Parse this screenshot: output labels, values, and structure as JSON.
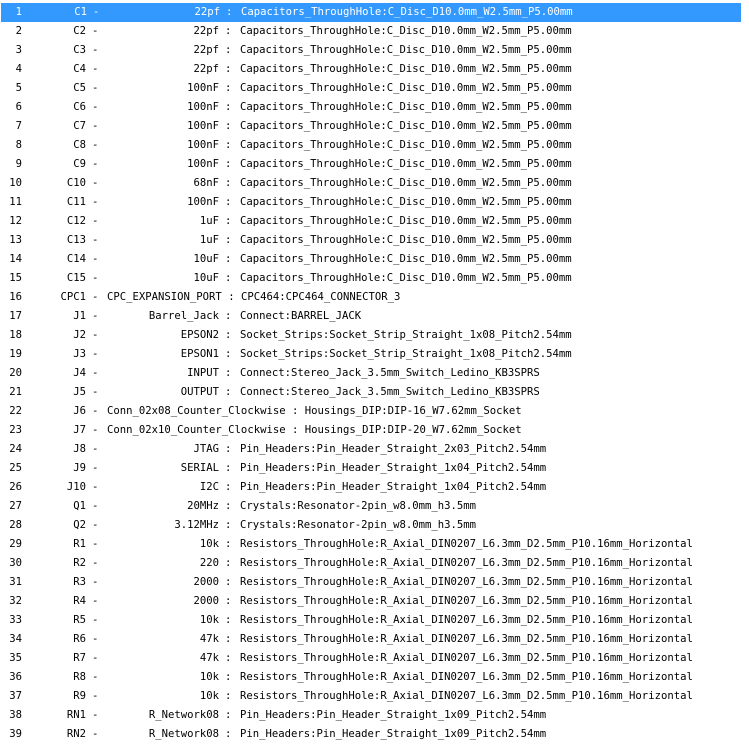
{
  "colors": {
    "selection": "#3399ff",
    "selection_text": "#ffffff",
    "text": "#000000",
    "background": "#ffffff"
  },
  "rows": [
    {
      "num": "1",
      "ref": "C1",
      "value": "22pf",
      "footprint": "Capacitors_ThroughHole:C_Disc_D10.0mm_W2.5mm_P5.00mm"
    },
    {
      "num": "2",
      "ref": "C2",
      "value": "22pf",
      "footprint": "Capacitors_ThroughHole:C_Disc_D10.0mm_W2.5mm_P5.00mm"
    },
    {
      "num": "3",
      "ref": "C3",
      "value": "22pf",
      "footprint": "Capacitors_ThroughHole:C_Disc_D10.0mm_W2.5mm_P5.00mm"
    },
    {
      "num": "4",
      "ref": "C4",
      "value": "22pf",
      "footprint": "Capacitors_ThroughHole:C_Disc_D10.0mm_W2.5mm_P5.00mm"
    },
    {
      "num": "5",
      "ref": "C5",
      "value": "100nF",
      "footprint": "Capacitors_ThroughHole:C_Disc_D10.0mm_W2.5mm_P5.00mm"
    },
    {
      "num": "6",
      "ref": "C6",
      "value": "100nF",
      "footprint": "Capacitors_ThroughHole:C_Disc_D10.0mm_W2.5mm_P5.00mm"
    },
    {
      "num": "7",
      "ref": "C7",
      "value": "100nF",
      "footprint": "Capacitors_ThroughHole:C_Disc_D10.0mm_W2.5mm_P5.00mm"
    },
    {
      "num": "8",
      "ref": "C8",
      "value": "100nF",
      "footprint": "Capacitors_ThroughHole:C_Disc_D10.0mm_W2.5mm_P5.00mm"
    },
    {
      "num": "9",
      "ref": "C9",
      "value": "100nF",
      "footprint": "Capacitors_ThroughHole:C_Disc_D10.0mm_W2.5mm_P5.00mm"
    },
    {
      "num": "10",
      "ref": "C10",
      "value": "68nF",
      "footprint": "Capacitors_ThroughHole:C_Disc_D10.0mm_W2.5mm_P5.00mm"
    },
    {
      "num": "11",
      "ref": "C11",
      "value": "100nF",
      "footprint": "Capacitors_ThroughHole:C_Disc_D10.0mm_W2.5mm_P5.00mm"
    },
    {
      "num": "12",
      "ref": "C12",
      "value": "1uF",
      "footprint": "Capacitors_ThroughHole:C_Disc_D10.0mm_W2.5mm_P5.00mm"
    },
    {
      "num": "13",
      "ref": "C13",
      "value": "1uF",
      "footprint": "Capacitors_ThroughHole:C_Disc_D10.0mm_W2.5mm_P5.00mm"
    },
    {
      "num": "14",
      "ref": "C14",
      "value": "10uF",
      "footprint": "Capacitors_ThroughHole:C_Disc_D10.0mm_W2.5mm_P5.00mm"
    },
    {
      "num": "15",
      "ref": "C15",
      "value": "10uF",
      "footprint": "Capacitors_ThroughHole:C_Disc_D10.0mm_W2.5mm_P5.00mm"
    },
    {
      "num": "16",
      "ref": "CPC1",
      "value": "CPC_EXPANSION_PORT",
      "footprint": "CPC464:CPC464_CONNECTOR_3",
      "long": true
    },
    {
      "num": "17",
      "ref": "J1",
      "value": "Barrel_Jack",
      "footprint": "Connect:BARREL_JACK"
    },
    {
      "num": "18",
      "ref": "J2",
      "value": "EPSON2",
      "footprint": "Socket_Strips:Socket_Strip_Straight_1x08_Pitch2.54mm"
    },
    {
      "num": "19",
      "ref": "J3",
      "value": "EPSON1",
      "footprint": "Socket_Strips:Socket_Strip_Straight_1x08_Pitch2.54mm"
    },
    {
      "num": "20",
      "ref": "J4",
      "value": "INPUT",
      "footprint": "Connect:Stereo_Jack_3.5mm_Switch_Ledino_KB3SPRS"
    },
    {
      "num": "21",
      "ref": "J5",
      "value": "OUTPUT",
      "footprint": "Connect:Stereo_Jack_3.5mm_Switch_Ledino_KB3SPRS"
    },
    {
      "num": "22",
      "ref": "J6",
      "value": "Conn_02x08_Counter_Clockwise",
      "footprint": "Housings_DIP:DIP-16_W7.62mm_Socket",
      "long": true
    },
    {
      "num": "23",
      "ref": "J7",
      "value": "Conn_02x10_Counter_Clockwise",
      "footprint": "Housings_DIP:DIP-20_W7.62mm_Socket",
      "long": true
    },
    {
      "num": "24",
      "ref": "J8",
      "value": "JTAG",
      "footprint": "Pin_Headers:Pin_Header_Straight_2x03_Pitch2.54mm"
    },
    {
      "num": "25",
      "ref": "J9",
      "value": "SERIAL",
      "footprint": "Pin_Headers:Pin_Header_Straight_1x04_Pitch2.54mm"
    },
    {
      "num": "26",
      "ref": "J10",
      "value": "I2C",
      "footprint": "Pin_Headers:Pin_Header_Straight_1x04_Pitch2.54mm"
    },
    {
      "num": "27",
      "ref": "Q1",
      "value": "20MHz",
      "footprint": "Crystals:Resonator-2pin_w8.0mm_h3.5mm"
    },
    {
      "num": "28",
      "ref": "Q2",
      "value": "3.12MHz",
      "footprint": "Crystals:Resonator-2pin_w8.0mm_h3.5mm"
    },
    {
      "num": "29",
      "ref": "R1",
      "value": "10k",
      "footprint": "Resistors_ThroughHole:R_Axial_DIN0207_L6.3mm_D2.5mm_P10.16mm_Horizontal"
    },
    {
      "num": "30",
      "ref": "R2",
      "value": "220",
      "footprint": "Resistors_ThroughHole:R_Axial_DIN0207_L6.3mm_D2.5mm_P10.16mm_Horizontal"
    },
    {
      "num": "31",
      "ref": "R3",
      "value": "2000",
      "footprint": "Resistors_ThroughHole:R_Axial_DIN0207_L6.3mm_D2.5mm_P10.16mm_Horizontal"
    },
    {
      "num": "32",
      "ref": "R4",
      "value": "2000",
      "footprint": "Resistors_ThroughHole:R_Axial_DIN0207_L6.3mm_D2.5mm_P10.16mm_Horizontal"
    },
    {
      "num": "33",
      "ref": "R5",
      "value": "10k",
      "footprint": "Resistors_ThroughHole:R_Axial_DIN0207_L6.3mm_D2.5mm_P10.16mm_Horizontal"
    },
    {
      "num": "34",
      "ref": "R6",
      "value": "47k",
      "footprint": "Resistors_ThroughHole:R_Axial_DIN0207_L6.3mm_D2.5mm_P10.16mm_Horizontal"
    },
    {
      "num": "35",
      "ref": "R7",
      "value": "47k",
      "footprint": "Resistors_ThroughHole:R_Axial_DIN0207_L6.3mm_D2.5mm_P10.16mm_Horizontal"
    },
    {
      "num": "36",
      "ref": "R8",
      "value": "10k",
      "footprint": "Resistors_ThroughHole:R_Axial_DIN0207_L6.3mm_D2.5mm_P10.16mm_Horizontal"
    },
    {
      "num": "37",
      "ref": "R9",
      "value": "10k",
      "footprint": "Resistors_ThroughHole:R_Axial_DIN0207_L6.3mm_D2.5mm_P10.16mm_Horizontal"
    },
    {
      "num": "38",
      "ref": "RN1",
      "value": "R_Network08",
      "footprint": "Pin_Headers:Pin_Header_Straight_1x09_Pitch2.54mm"
    },
    {
      "num": "39",
      "ref": "RN2",
      "value": "R_Network08",
      "footprint": "Pin_Headers:Pin_Header_Straight_1x09_Pitch2.54mm"
    }
  ],
  "selected_index": 0
}
